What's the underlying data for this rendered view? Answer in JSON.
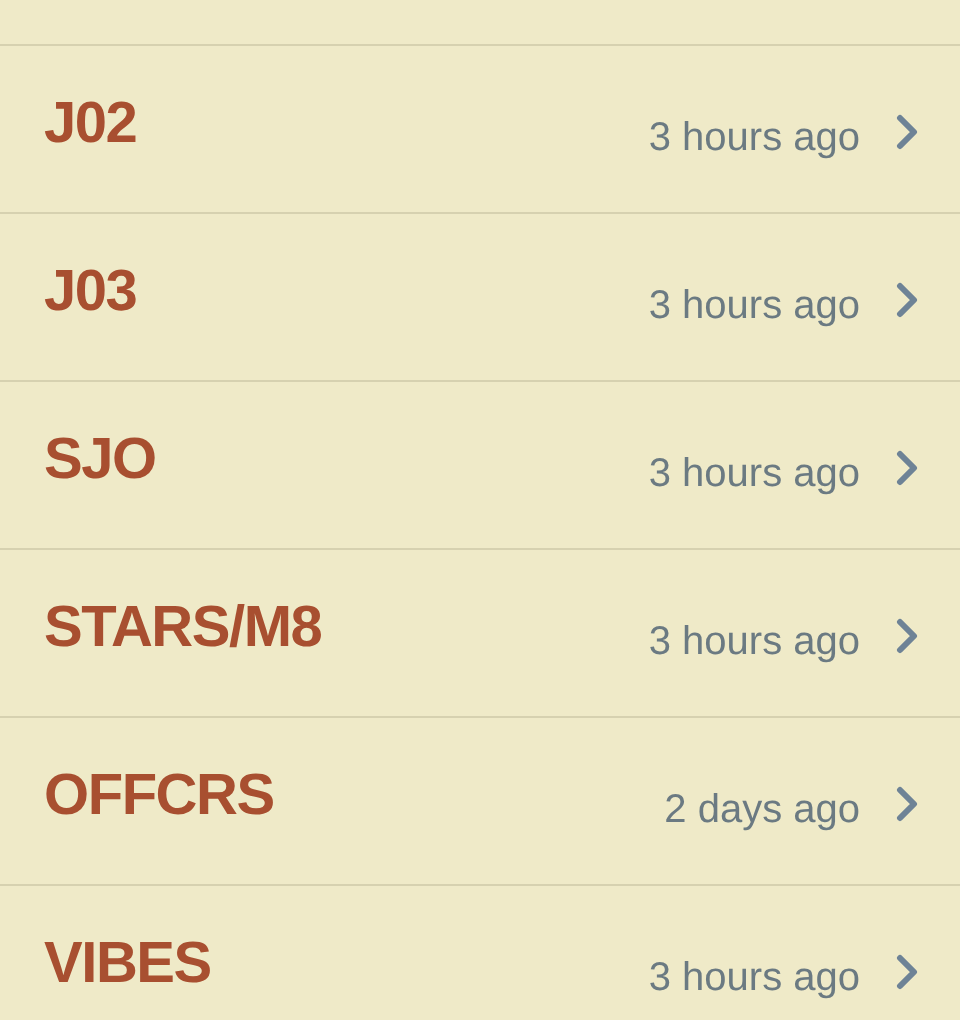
{
  "rows": [
    {
      "title": "J02",
      "time": "3 hours ago"
    },
    {
      "title": "J03",
      "time": "3 hours ago"
    },
    {
      "title": "SJO",
      "time": "3 hours ago"
    },
    {
      "title": "STARS/M8",
      "time": "3 hours ago"
    },
    {
      "title": "OFFCRS",
      "time": "2 days ago"
    },
    {
      "title": "VIBES",
      "time": "3 hours ago"
    }
  ]
}
